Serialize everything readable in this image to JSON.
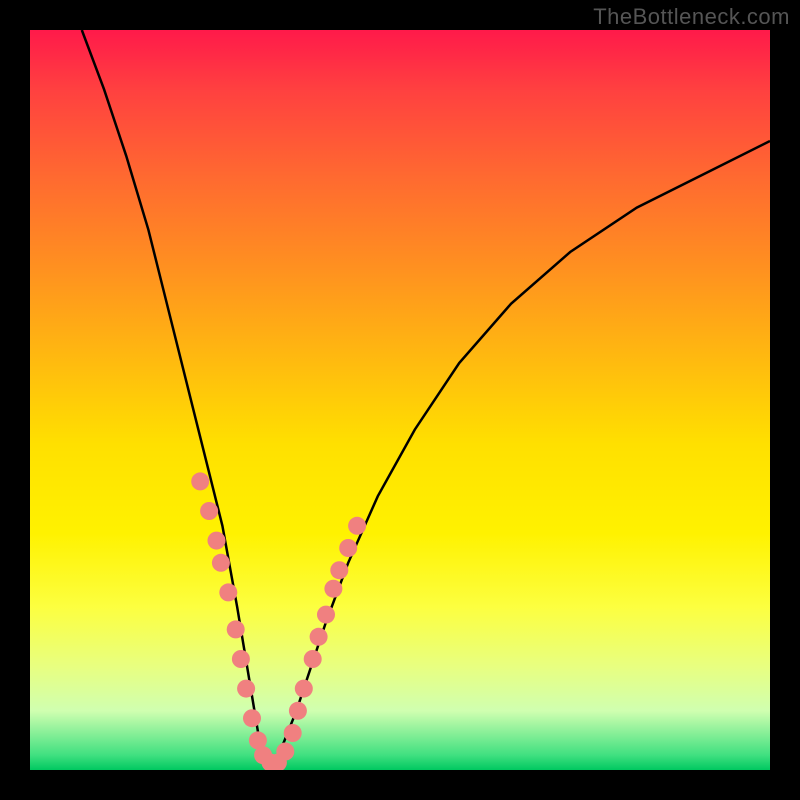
{
  "watermark": "TheBottleneck.com",
  "chart_data": {
    "type": "line",
    "title": "",
    "xlabel": "",
    "ylabel": "",
    "xlim": [
      0,
      100
    ],
    "ylim": [
      0,
      100
    ],
    "series": [
      {
        "name": "curve",
        "x": [
          7,
          10,
          13,
          16,
          18,
          20,
          22,
          24,
          26,
          28,
          29,
          30,
          31,
          32,
          33,
          34,
          36,
          38,
          40,
          43,
          47,
          52,
          58,
          65,
          73,
          82,
          92,
          100
        ],
        "y": [
          100,
          92,
          83,
          73,
          65,
          57,
          49,
          41,
          33,
          22,
          16,
          10,
          4,
          1,
          1,
          3,
          8,
          14,
          20,
          28,
          37,
          46,
          55,
          63,
          70,
          76,
          81,
          85
        ]
      }
    ],
    "markers": [
      {
        "x": 23.0,
        "y": 39.0
      },
      {
        "x": 24.2,
        "y": 35.0
      },
      {
        "x": 25.2,
        "y": 31.0
      },
      {
        "x": 25.8,
        "y": 28.0
      },
      {
        "x": 26.8,
        "y": 24.0
      },
      {
        "x": 27.8,
        "y": 19.0
      },
      {
        "x": 28.5,
        "y": 15.0
      },
      {
        "x": 29.2,
        "y": 11.0
      },
      {
        "x": 30.0,
        "y": 7.0
      },
      {
        "x": 30.8,
        "y": 4.0
      },
      {
        "x": 31.5,
        "y": 2.0
      },
      {
        "x": 32.5,
        "y": 1.0
      },
      {
        "x": 33.5,
        "y": 1.0
      },
      {
        "x": 34.5,
        "y": 2.5
      },
      {
        "x": 35.5,
        "y": 5.0
      },
      {
        "x": 36.2,
        "y": 8.0
      },
      {
        "x": 37.0,
        "y": 11.0
      },
      {
        "x": 38.2,
        "y": 15.0
      },
      {
        "x": 39.0,
        "y": 18.0
      },
      {
        "x": 40.0,
        "y": 21.0
      },
      {
        "x": 41.0,
        "y": 24.5
      },
      {
        "x": 41.8,
        "y": 27.0
      },
      {
        "x": 43.0,
        "y": 30.0
      },
      {
        "x": 44.2,
        "y": 33.0
      }
    ],
    "marker_color": "#f08080",
    "marker_radius": 9
  }
}
